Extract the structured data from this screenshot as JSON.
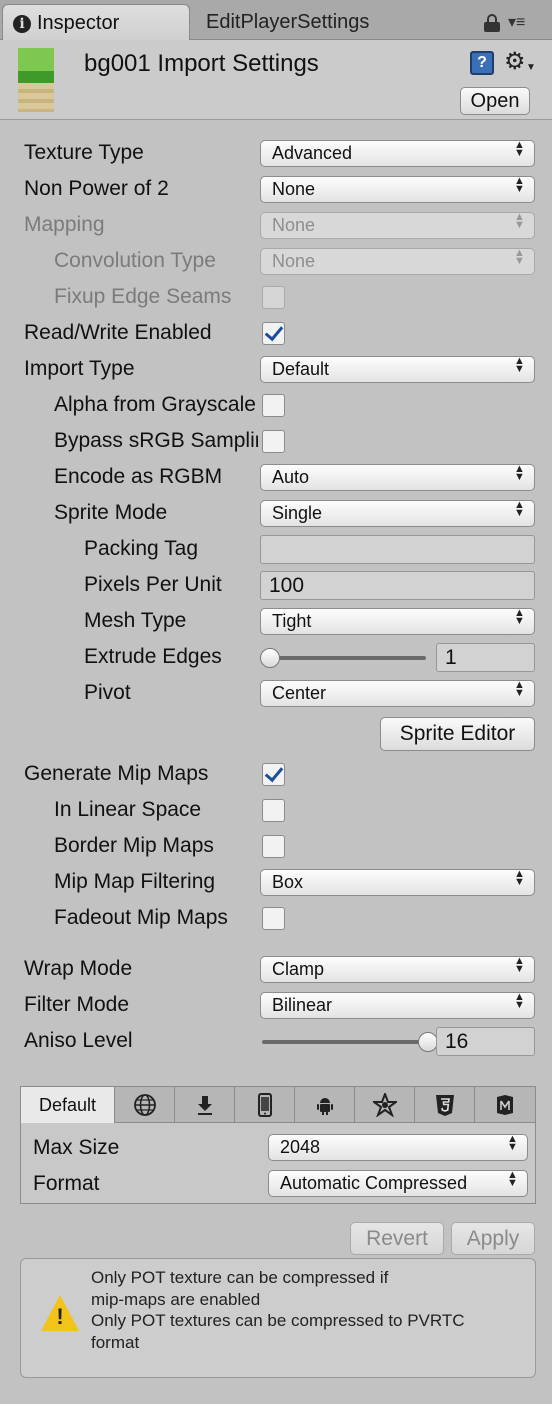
{
  "tabs": {
    "inspector": "Inspector",
    "second": "EditPlayerSettings"
  },
  "header": {
    "title": "bg001 Import Settings",
    "open_label": "Open",
    "help_icon": "?"
  },
  "rows": {
    "texture_type": {
      "label": "Texture Type",
      "value": "Advanced"
    },
    "non_power_of_2": {
      "label": "Non Power of 2",
      "value": "None"
    },
    "mapping": {
      "label": "Mapping",
      "value": "None"
    },
    "convolution_type": {
      "label": "Convolution Type",
      "value": "None"
    },
    "fixup_edge_seams": {
      "label": "Fixup Edge Seams"
    },
    "read_write_enabled": {
      "label": "Read/Write Enabled"
    },
    "import_type": {
      "label": "Import Type",
      "value": "Default"
    },
    "alpha_from_grayscale": {
      "label": "Alpha from Grayscale"
    },
    "bypass_srgb": {
      "label": "Bypass sRGB Sampling"
    },
    "encode_rgbm": {
      "label": "Encode as RGBM",
      "value": "Auto"
    },
    "sprite_mode": {
      "label": "Sprite Mode",
      "value": "Single"
    },
    "packing_tag": {
      "label": "Packing Tag",
      "value": ""
    },
    "pixels_per_unit": {
      "label": "Pixels Per Unit",
      "value": "100"
    },
    "mesh_type": {
      "label": "Mesh Type",
      "value": "Tight"
    },
    "extrude_edges": {
      "label": "Extrude Edges",
      "value": "1",
      "level": 0.0
    },
    "pivot": {
      "label": "Pivot",
      "value": "Center"
    },
    "generate_mip_maps": {
      "label": "Generate Mip Maps"
    },
    "in_linear_space": {
      "label": "In Linear Space"
    },
    "border_mip_maps": {
      "label": "Border Mip Maps"
    },
    "mip_map_filtering": {
      "label": "Mip Map Filtering",
      "value": "Box"
    },
    "fadeout_mip_maps": {
      "label": "Fadeout Mip Maps"
    },
    "wrap_mode": {
      "label": "Wrap Mode",
      "value": "Clamp"
    },
    "filter_mode": {
      "label": "Filter Mode",
      "value": "Bilinear"
    },
    "aniso_level": {
      "label": "Aniso Level",
      "value": "16",
      "level": 1.0
    }
  },
  "sprite_editor_label": "Sprite Editor",
  "platform": {
    "default_tab": "Default",
    "tab_icons": [
      "globe-icon",
      "download-icon",
      "phone-icon",
      "android-icon",
      "blackberry-icon",
      "html5-icon",
      "windows-store-icon"
    ],
    "max_size": {
      "label": "Max Size",
      "value": "2048"
    },
    "format": {
      "label": "Format",
      "value": "Automatic Compressed"
    }
  },
  "actions": {
    "revert": "Revert",
    "apply": "Apply"
  },
  "warning": {
    "lines": [
      "Only POT texture can be compressed if",
      "mip-maps are enabled",
      "Only POT textures can be compressed to PVRTC",
      "format"
    ]
  },
  "colors": {
    "checkmark": "#1d4e99",
    "warning": "#f2c318",
    "panel": "#c2c2c2"
  }
}
